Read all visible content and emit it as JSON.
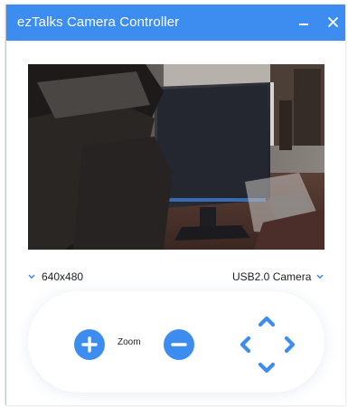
{
  "window": {
    "title": "ezTalks Camera Controller",
    "accent_color": "#3d8df0",
    "minimize_icon": "minimize-icon",
    "close_icon": "close-icon"
  },
  "preview": {
    "content": "live-camera-feed"
  },
  "settings": {
    "resolution": "640x480",
    "camera": "USB2.0 Camera"
  },
  "controls": {
    "zoom_label": "Zoom",
    "zoom_in_icon": "plus-icon",
    "zoom_out_icon": "minus-icon",
    "pan_icons": [
      "chevron-up-icon",
      "chevron-down-icon",
      "chevron-left-icon",
      "chevron-right-icon"
    ]
  }
}
